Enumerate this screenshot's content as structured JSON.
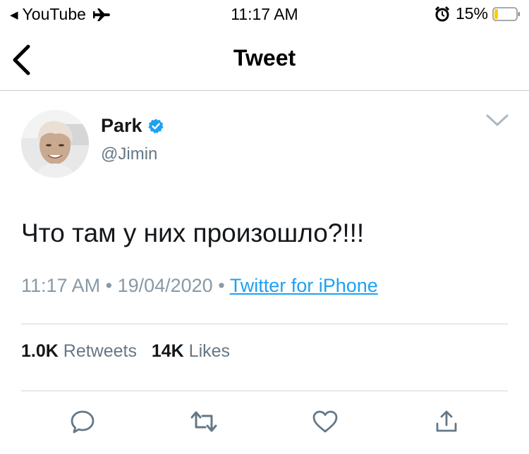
{
  "status_bar": {
    "back_app": "YouTube",
    "time": "11:17 AM",
    "battery": "15%",
    "battery_level": 0.15
  },
  "nav": {
    "title": "Tweet"
  },
  "tweet": {
    "author_name": "Park",
    "author_handle": "@Jimin",
    "text": "Что там у них произошло?!!!",
    "time": "11:17 AM",
    "date": "19/04/2020",
    "separator": "•",
    "source": "Twitter for iPhone"
  },
  "stats": {
    "retweets_count": "1.0K",
    "retweets_label": "Retweets",
    "likes_count": "14K",
    "likes_label": "Likes"
  },
  "icons": {
    "reply": "reply-icon",
    "retweet": "retweet-icon",
    "like": "heart-icon",
    "share": "share-icon",
    "verified": "verified-badge-icon",
    "chevron": "chevron-down-icon"
  },
  "colors": {
    "link": "#1da1f2",
    "secondary_text": "#657786",
    "meta_text": "#8899a6",
    "battery_low": "#ffcc00"
  }
}
